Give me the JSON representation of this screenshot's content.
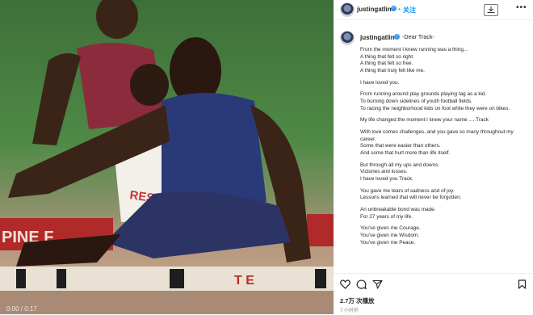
{
  "header": {
    "username": "justingatlin",
    "separator": "•",
    "follow_label": "关注",
    "more_label": "•••"
  },
  "caption": {
    "username": "justingatlin",
    "title": "-Dear Track-",
    "paragraphs": [
      [
        "From the moment I knew running was a thing...",
        "A thing that felt so right.",
        "A thing that felt so free.",
        "A thing that truly felt like me."
      ],
      [
        "I have loved you."
      ],
      [
        "From running around play grounds playing tag as a kid.",
        "To burning down sidelines of youth football fields.",
        "To racing the neighborhood kids on foot while they were on bikes."
      ],
      [
        "My life changed the moment I knew your name .....Track"
      ],
      [
        "With love comes challenges, and you gave so many throughout my",
        "career.",
        "Some that were easier than others.",
        "And some that hurt more than life itself."
      ],
      [
        "But through all my ups and downs.",
        "Victories and losses.",
        "I have loved you Track."
      ],
      [
        "You gave me tears of sadness and of joy.",
        "Lessons learned that will never be forgotten."
      ],
      [
        "An unbreakable bond was made.",
        "For 27 years of my life."
      ],
      [
        "You've given me Courage.",
        "You've given me Wisdom.",
        "You've given me Peace."
      ]
    ]
  },
  "stats": {
    "views": "2.7万 次播放",
    "time_ago": "7 小时前"
  },
  "photo": {
    "counter": "0:00 / 0:17",
    "sign_text": "PINE F",
    "jersey_text": "RESTVIE",
    "hurdle_text": "T E"
  },
  "icons": {
    "like": "heart-icon",
    "comment": "comment-icon",
    "share": "share-icon",
    "save": "bookmark-icon",
    "download": "download-icon",
    "verified": "verified-badge-icon"
  },
  "colors": {
    "link": "#0095f6",
    "verified": "#3897f0",
    "text": "#262626",
    "muted": "#8e8e8e"
  }
}
